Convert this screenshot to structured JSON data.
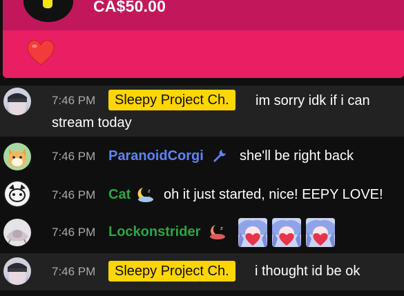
{
  "super_chat": {
    "amount": "CA$50.00",
    "message_icon": "red-heart-icon",
    "header_color": "#c2185b",
    "body_color": "#e91e63"
  },
  "messages": [
    {
      "timestamp": "7:46 PM",
      "author": "Sleepy Project Ch.",
      "author_style": "owner-badge",
      "text_line1": "im sorry idk if i can",
      "text_line2": "stream today"
    },
    {
      "timestamp": "7:46 PM",
      "author": "ParanoidCorgi",
      "author_color": "#5e84f1",
      "author_icon": "wrench-icon",
      "text": "she'll be right back"
    },
    {
      "timestamp": "7:46 PM",
      "author": "Cat",
      "author_color": "#2ba640",
      "author_icon": "moon-icon",
      "text": "oh it just started, nice! EEPY LOVE!"
    },
    {
      "timestamp": "7:46 PM",
      "author": "Lockonstrider",
      "author_color": "#2ba640",
      "author_icon": "moon-icon",
      "emotes": [
        "heart-emote",
        "heart-emote",
        "heart-emote"
      ]
    },
    {
      "timestamp": "7:46 PM",
      "author": "Sleepy Project Ch.",
      "author_style": "owner-badge",
      "text": "i thought id be ok"
    }
  ],
  "colors": {
    "owner_badge": "#ffd600",
    "highlight_row": "#222222",
    "background": "#0f0f0f"
  }
}
